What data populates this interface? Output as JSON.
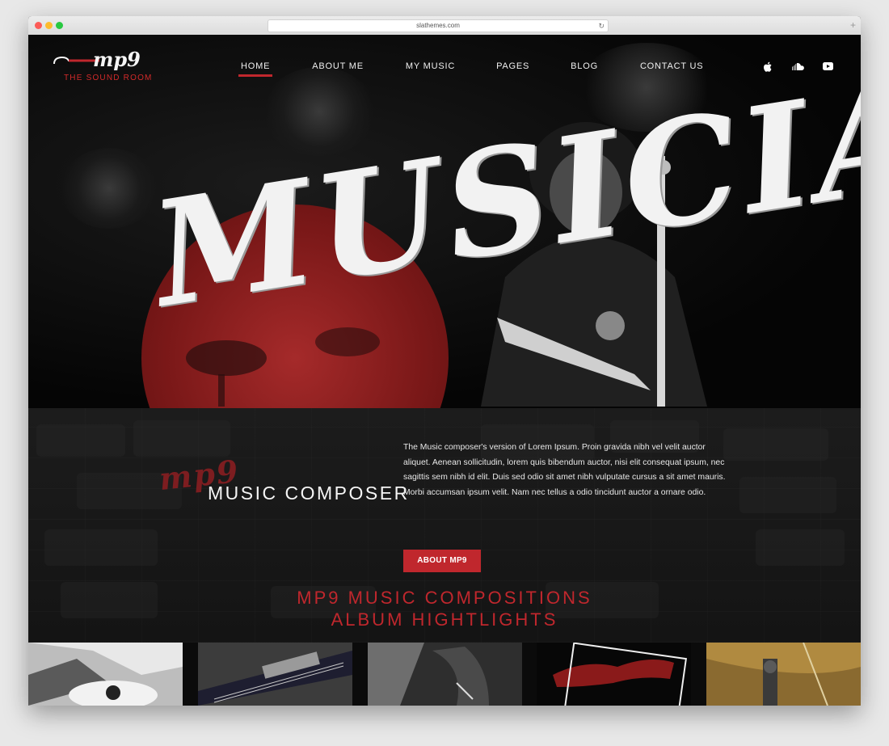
{
  "browser": {
    "url": "slathemes.com"
  },
  "nav": {
    "logo_text": "mp9",
    "logo_subtitle": "THE SOUND ROOM",
    "menu": [
      {
        "label": "HOME",
        "active": true
      },
      {
        "label": "ABOUT ME",
        "active": false
      },
      {
        "label": "MY MUSIC",
        "active": false
      },
      {
        "label": "PAGES",
        "active": false
      },
      {
        "label": "BLOG",
        "active": false
      },
      {
        "label": "CONTACT US",
        "active": false
      }
    ],
    "social_icons": [
      "apple-icon",
      "soundcloud-icon",
      "youtube-icon"
    ]
  },
  "hero": {
    "headline": "MUSICIAN"
  },
  "composer": {
    "script_text": "mp9",
    "title": "MUSIC COMPOSER",
    "body": "The Music composer's version of Lorem Ipsum. Proin gravida nibh vel velit auctor aliquet. Aenean sollicitudin, lorem quis bibendum auctor, nisi elit consequat ipsum, nec sagittis sem nibh id elit. Duis sed odio sit amet nibh vulputate cursus a sit amet mauris. Morbi accumsan ipsum velit. Nam nec tellus a odio tincidunt auctor a ornare odio.",
    "button_label": "ABOUT MP9"
  },
  "compositions": {
    "line1": "MP9 MUSIC COMPOSITIONS",
    "line2": "ALBUM HIGHTLIGHTS"
  },
  "gallery": {
    "tiles": [
      "guitar-photo",
      "electric-guitar-photo",
      "guitarist-photo",
      "album-photo",
      "guitar-closeup-photo"
    ]
  },
  "colors": {
    "accent": "#c0272d",
    "background": "#0b0b0b"
  }
}
